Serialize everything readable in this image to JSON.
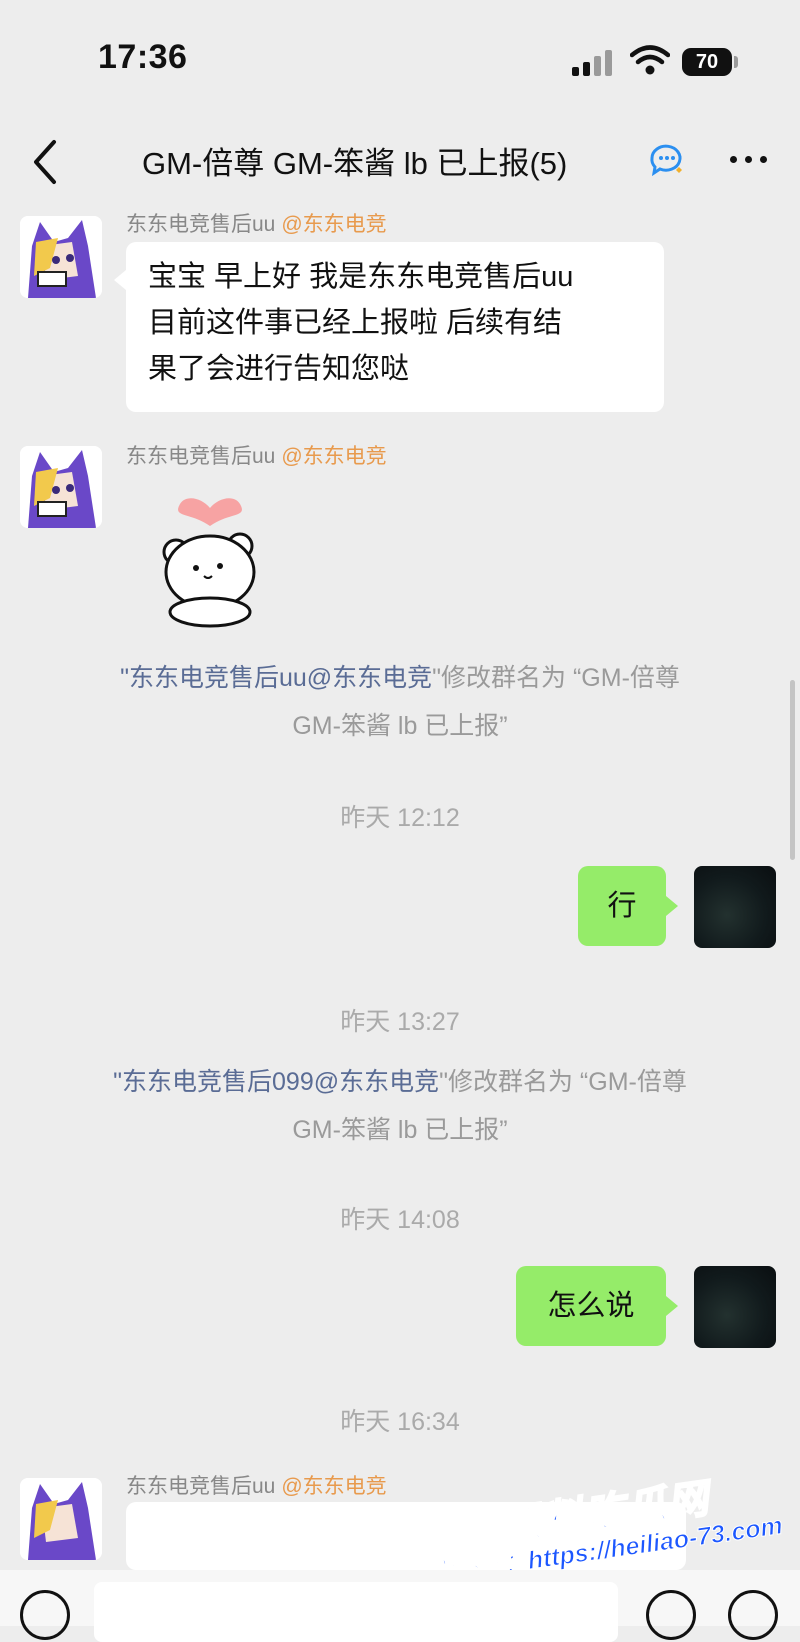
{
  "status_bar": {
    "time": "17:36",
    "battery": "70"
  },
  "nav": {
    "title": "GM-倍尊 GM-笨酱  lb 已上报(5)",
    "back_icon": "chevron-left-icon",
    "more_icon": "more-dots-icon"
  },
  "messages": [
    {
      "sender": "东东电竞售后uu",
      "org": "@东东电竞",
      "lines": [
        "宝宝 早上好 我是东东电竞售后uu",
        "目前这件事已经上报啦 后续有结",
        "果了会进行告知您哒"
      ]
    },
    {
      "sender": "东东电竞售后uu",
      "org": "@东东电竞",
      "sticker": "bear-heart-sticker"
    }
  ],
  "system_1": {
    "name": "\"东东电竞售后uu@东东电竞",
    "rest": "\"修改群名为 “GM-倍尊",
    "line2": "GM-笨酱  lb 已上报”"
  },
  "time_1": "昨天 12:12",
  "reply_1": "行",
  "time_2": "昨天 13:27",
  "system_2": {
    "name": "\"东东电竞售后099@东东电竞",
    "rest": "\"修改群名为 “GM-倍尊",
    "line2": "GM-笨酱  lb 已上报”"
  },
  "time_3": "昨天 14:08",
  "reply_2": "怎么说",
  "time_4": "昨天 16:34",
  "last_sender": {
    "sender": "东东电竞售后uu",
    "org": "@东东电竞"
  },
  "watermark": {
    "line1": "黑料吃瓜网",
    "line2": "看完整版：https://heiliao-73.com"
  },
  "colors": {
    "background": "#ededed",
    "my_bubble": "#95ec69",
    "org_tag": "#e89a4d",
    "system_name": "#5a6c95"
  }
}
